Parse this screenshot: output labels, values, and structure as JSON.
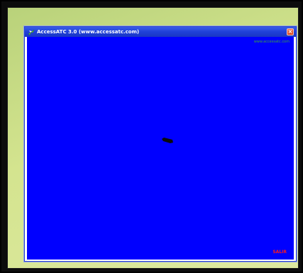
{
  "window": {
    "title": "AccessATC 3.0 (www.accessatc.com)",
    "close_label": "×"
  },
  "radar": {
    "site_label": "www.accessatc.com",
    "exit_label": "SALIR"
  },
  "colors": {
    "radar_background": "#0000ff",
    "titlebar": "#1f40d8",
    "site_label": "#3aa63a",
    "exit_label": "#ff1a1a",
    "desktop": "#d4e48f"
  },
  "icons": {
    "title_icon": "app-plane-icon",
    "close_icon": "close-icon",
    "aircraft": "aircraft-target-icon"
  }
}
